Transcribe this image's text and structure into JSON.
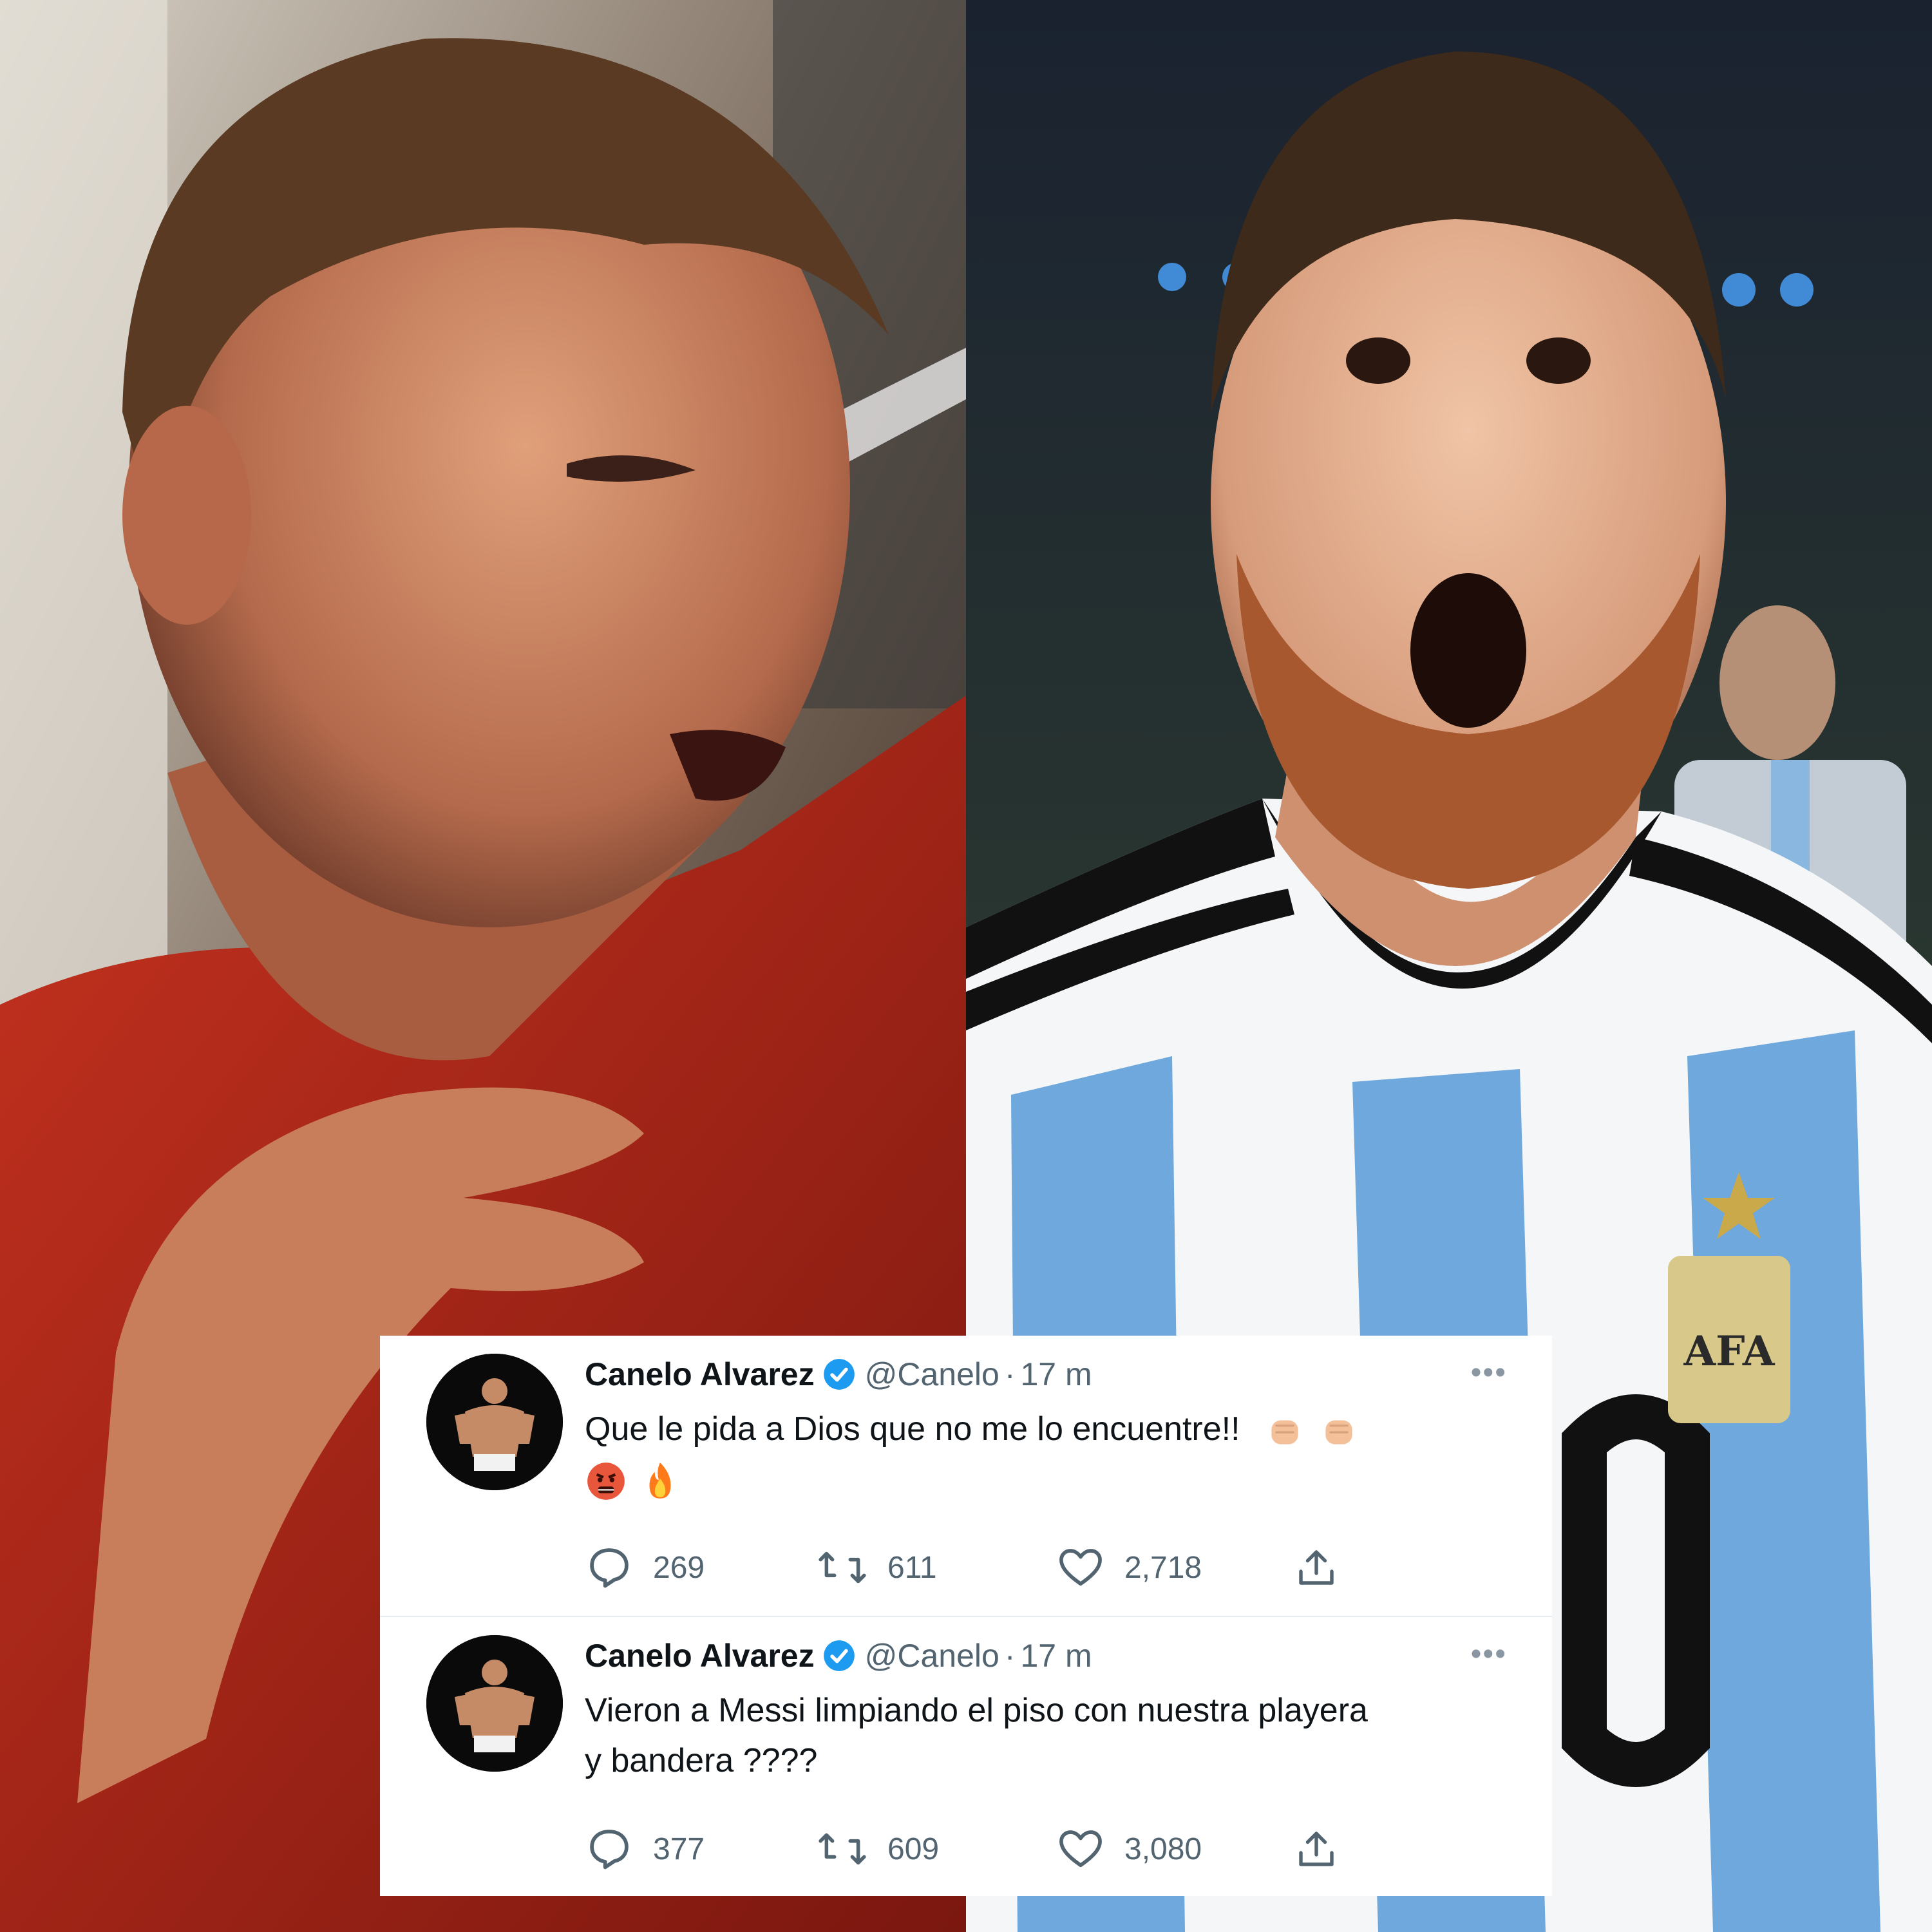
{
  "photos": {
    "left": {
      "subject": "boxer-in-red-shirt"
    },
    "right": {
      "subject": "footballer-in-argentina-jersey",
      "badge_text": "AFA"
    }
  },
  "colors": {
    "verified": "#1d9bf0",
    "text": "#0f1419",
    "muted": "#536471",
    "card_bg": "#ffffff"
  },
  "tweets": [
    {
      "name": "Canelo Alvarez",
      "handle": "@Canelo",
      "separator": "·",
      "time": "17 m",
      "text_lines": [
        "Que le pida a Dios que no me lo encuentre!!"
      ],
      "emojis": [
        "fist-emoji",
        "fist-emoji",
        "angry-face-emoji",
        "fire-emoji"
      ],
      "replies": "269",
      "retweets": "611",
      "likes": "2,718"
    },
    {
      "name": "Canelo Alvarez",
      "handle": "@Canelo",
      "separator": "·",
      "time": "17 m",
      "text_lines": [
        "Vieron a Messi limpiando el piso con nuestra playera",
        "y bandera ????"
      ],
      "emojis": [],
      "replies": "377",
      "retweets": "609",
      "likes": "3,080"
    }
  ]
}
